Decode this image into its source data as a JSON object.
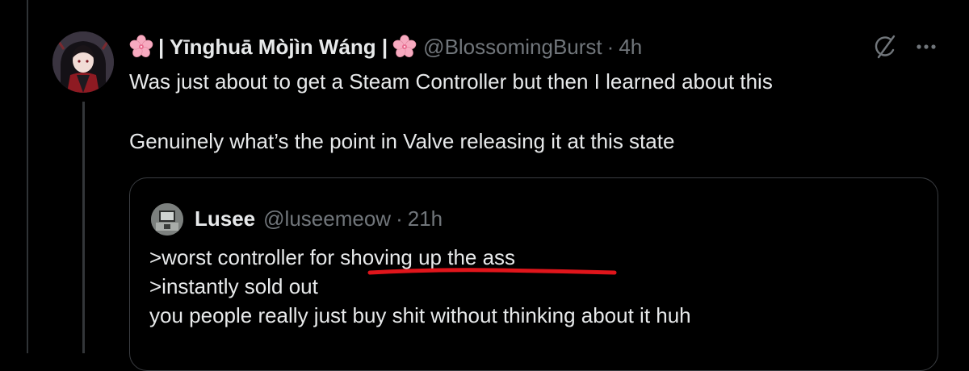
{
  "tweet": {
    "flower_emoji": "🌸",
    "display_name": "| Yīnghuā Mòjìn Wáng |",
    "handle": "@BlossomingBurst",
    "separator": "·",
    "time": "4h",
    "lines": [
      "Was just about to get a Steam Controller but then I learned about this",
      "Genuinely what’s the point in Valve releasing it at this state"
    ],
    "icons": [
      "grok-icon",
      "more-icon"
    ]
  },
  "quoted_tweet": {
    "display_name": "Lusee",
    "handle": "@luseemeow",
    "separator": "·",
    "time": "21h",
    "lines": [
      ">worst controller for shoving up the ass",
      ">instantly sold out",
      "you people really just buy shit without thinking about it huh"
    ]
  },
  "colors": {
    "background": "#000000",
    "text_primary": "#e7e9ea",
    "text_secondary": "#71767b",
    "border": "#3a3d41",
    "annotation_red": "#e0151b"
  }
}
